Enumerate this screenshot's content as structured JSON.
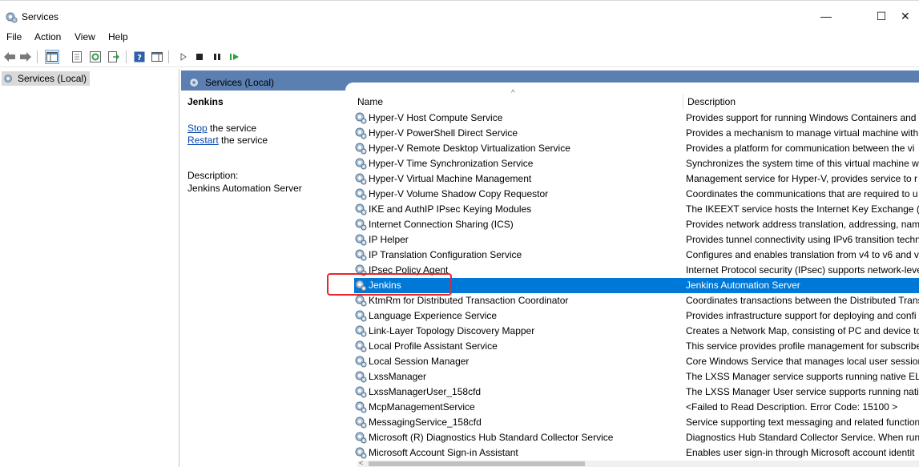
{
  "window": {
    "title": "Services",
    "minimize": "—",
    "maximize": "☐",
    "close": "✕"
  },
  "menu": [
    "File",
    "Action",
    "View",
    "Help"
  ],
  "tree": {
    "root": "Services (Local)"
  },
  "header": {
    "tab": "Services (Local)"
  },
  "extended": {
    "service_name": "Jenkins",
    "stop_link": "Stop",
    "stop_rest": " the service",
    "restart_link": "Restart",
    "restart_rest": " the service",
    "description_label": "Description:",
    "description_text": "Jenkins Automation Server"
  },
  "columns": {
    "name": "Name",
    "description": "Description",
    "sort_indicator": "^"
  },
  "services": [
    {
      "name": "Hyper-V Host Compute Service",
      "description": "Provides support for running Windows Containers and"
    },
    {
      "name": "Hyper-V PowerShell Direct Service",
      "description": "Provides a mechanism to manage virtual machine with"
    },
    {
      "name": "Hyper-V Remote Desktop Virtualization Service",
      "description": "Provides a platform for communication between the vi"
    },
    {
      "name": "Hyper-V Time Synchronization Service",
      "description": "Synchronizes the system time of this virtual machine w"
    },
    {
      "name": "Hyper-V Virtual Machine Management",
      "description": "Management service for Hyper-V, provides service to r"
    },
    {
      "name": "Hyper-V Volume Shadow Copy Requestor",
      "description": "Coordinates the communications that are required to u"
    },
    {
      "name": "IKE and AuthIP IPsec Keying Modules",
      "description": "The IKEEXT service hosts the Internet Key Exchange (IKE"
    },
    {
      "name": "Internet Connection Sharing (ICS)",
      "description": "Provides network address translation, addressing, name"
    },
    {
      "name": "IP Helper",
      "description": "Provides tunnel connectivity using IPv6 transition techn"
    },
    {
      "name": "IP Translation Configuration Service",
      "description": "Configures and enables translation from v4 to v6 and v"
    },
    {
      "name": "IPsec Policy Agent",
      "description": "Internet Protocol security (IPsec) supports network-leve"
    },
    {
      "name": "Jenkins",
      "description": "Jenkins Automation Server"
    },
    {
      "name": "KtmRm for Distributed Transaction Coordinator",
      "description": "Coordinates transactions between the Distributed Trans"
    },
    {
      "name": "Language Experience Service",
      "description": "Provides infrastructure support for deploying and confi"
    },
    {
      "name": "Link-Layer Topology Discovery Mapper",
      "description": "Creates a Network Map, consisting of PC and device to"
    },
    {
      "name": "Local Profile Assistant Service",
      "description": "This service provides profile management for subscribe"
    },
    {
      "name": "Local Session Manager",
      "description": "Core Windows Service that manages local user sessions"
    },
    {
      "name": "LxssManager",
      "description": "The LXSS Manager service supports running native ELF"
    },
    {
      "name": "LxssManagerUser_158cfd",
      "description": "The LXSS Manager User service supports running native"
    },
    {
      "name": "McpManagementService",
      "description": "<Failed to Read Description. Error Code: 15100 >"
    },
    {
      "name": "MessagingService_158cfd",
      "description": "Service supporting text messaging and related function"
    },
    {
      "name": "Microsoft (R) Diagnostics Hub Standard Collector Service",
      "description": "Diagnostics Hub Standard Collector Service. When runn"
    },
    {
      "name": "Microsoft Account Sign-in Assistant",
      "description": "Enables user sign-in through Microsoft account identit"
    }
  ],
  "selected_service": "Jenkins",
  "colors": {
    "selection": "#0078d7",
    "header_band": "#5a7fb0",
    "highlight": "#e8262b"
  }
}
